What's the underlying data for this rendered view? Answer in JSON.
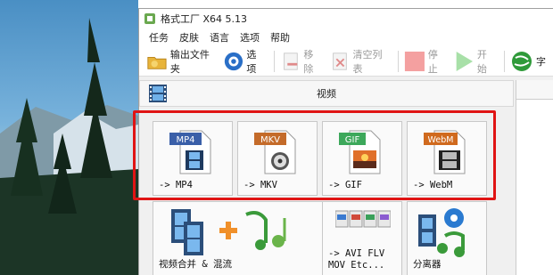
{
  "window": {
    "title": "格式工厂 X64 5.13"
  },
  "menu": [
    "任务",
    "皮肤",
    "语言",
    "选项",
    "帮助"
  ],
  "toolbar": {
    "output_folder": "输出文件夹",
    "options": "选项",
    "remove": "移除",
    "clear_list": "清空列表",
    "stop": "停止",
    "start": "开始",
    "extra": "字"
  },
  "panel": {
    "title": "视频"
  },
  "tiles": {
    "mp4": {
      "badge": "MP4",
      "label": "-> MP4",
      "badge_color": "#3a5fa8"
    },
    "mkv": {
      "badge": "MKV",
      "label": "-> MKV",
      "badge_color": "#c46b2a"
    },
    "gif": {
      "badge": "GIF",
      "label": "-> GIF",
      "badge_color": "#3da85b"
    },
    "webm": {
      "badge": "WebM",
      "label": "-> WebM",
      "badge_color": "#d06a1e"
    },
    "merge": {
      "label": "视频合并 & 混流"
    },
    "avi": {
      "label_line1": "-> AVI FLV",
      "label_line2": "MOV Etc..."
    },
    "splitter": {
      "label": "分离器"
    }
  },
  "colors": {
    "highlight": "#e01414"
  }
}
